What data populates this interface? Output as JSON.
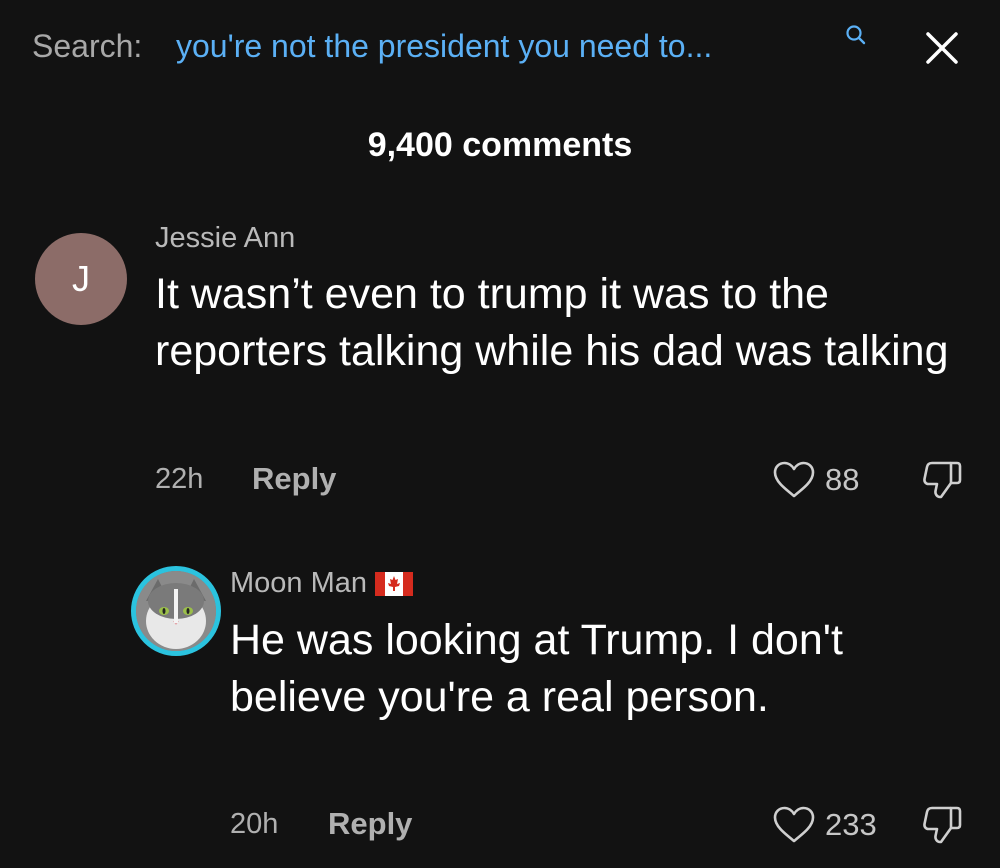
{
  "search": {
    "prefix": "Search:",
    "query": "you're not the president you need to..."
  },
  "comments_header": {
    "count_label": "9,400 comments"
  },
  "comments": [
    {
      "avatar_initial": "J",
      "username": "Jessie Ann",
      "text": "It wasn’t even to trump it was to the reporters talking while his dad was talking",
      "time": "22h",
      "reply_label": "Reply",
      "likes": "88"
    },
    {
      "username": "Moon Man",
      "flag_icon": "canada-flag-icon",
      "text": "He was looking at Trump. I don't believe you're a real person.",
      "time": "20h",
      "reply_label": "Reply",
      "likes": "233"
    }
  ],
  "colors": {
    "background": "#121212",
    "search_query": "#5bb0f5",
    "avatar_ring": "#2bc3df",
    "avatar_initial_bg": "#8c6c68"
  }
}
